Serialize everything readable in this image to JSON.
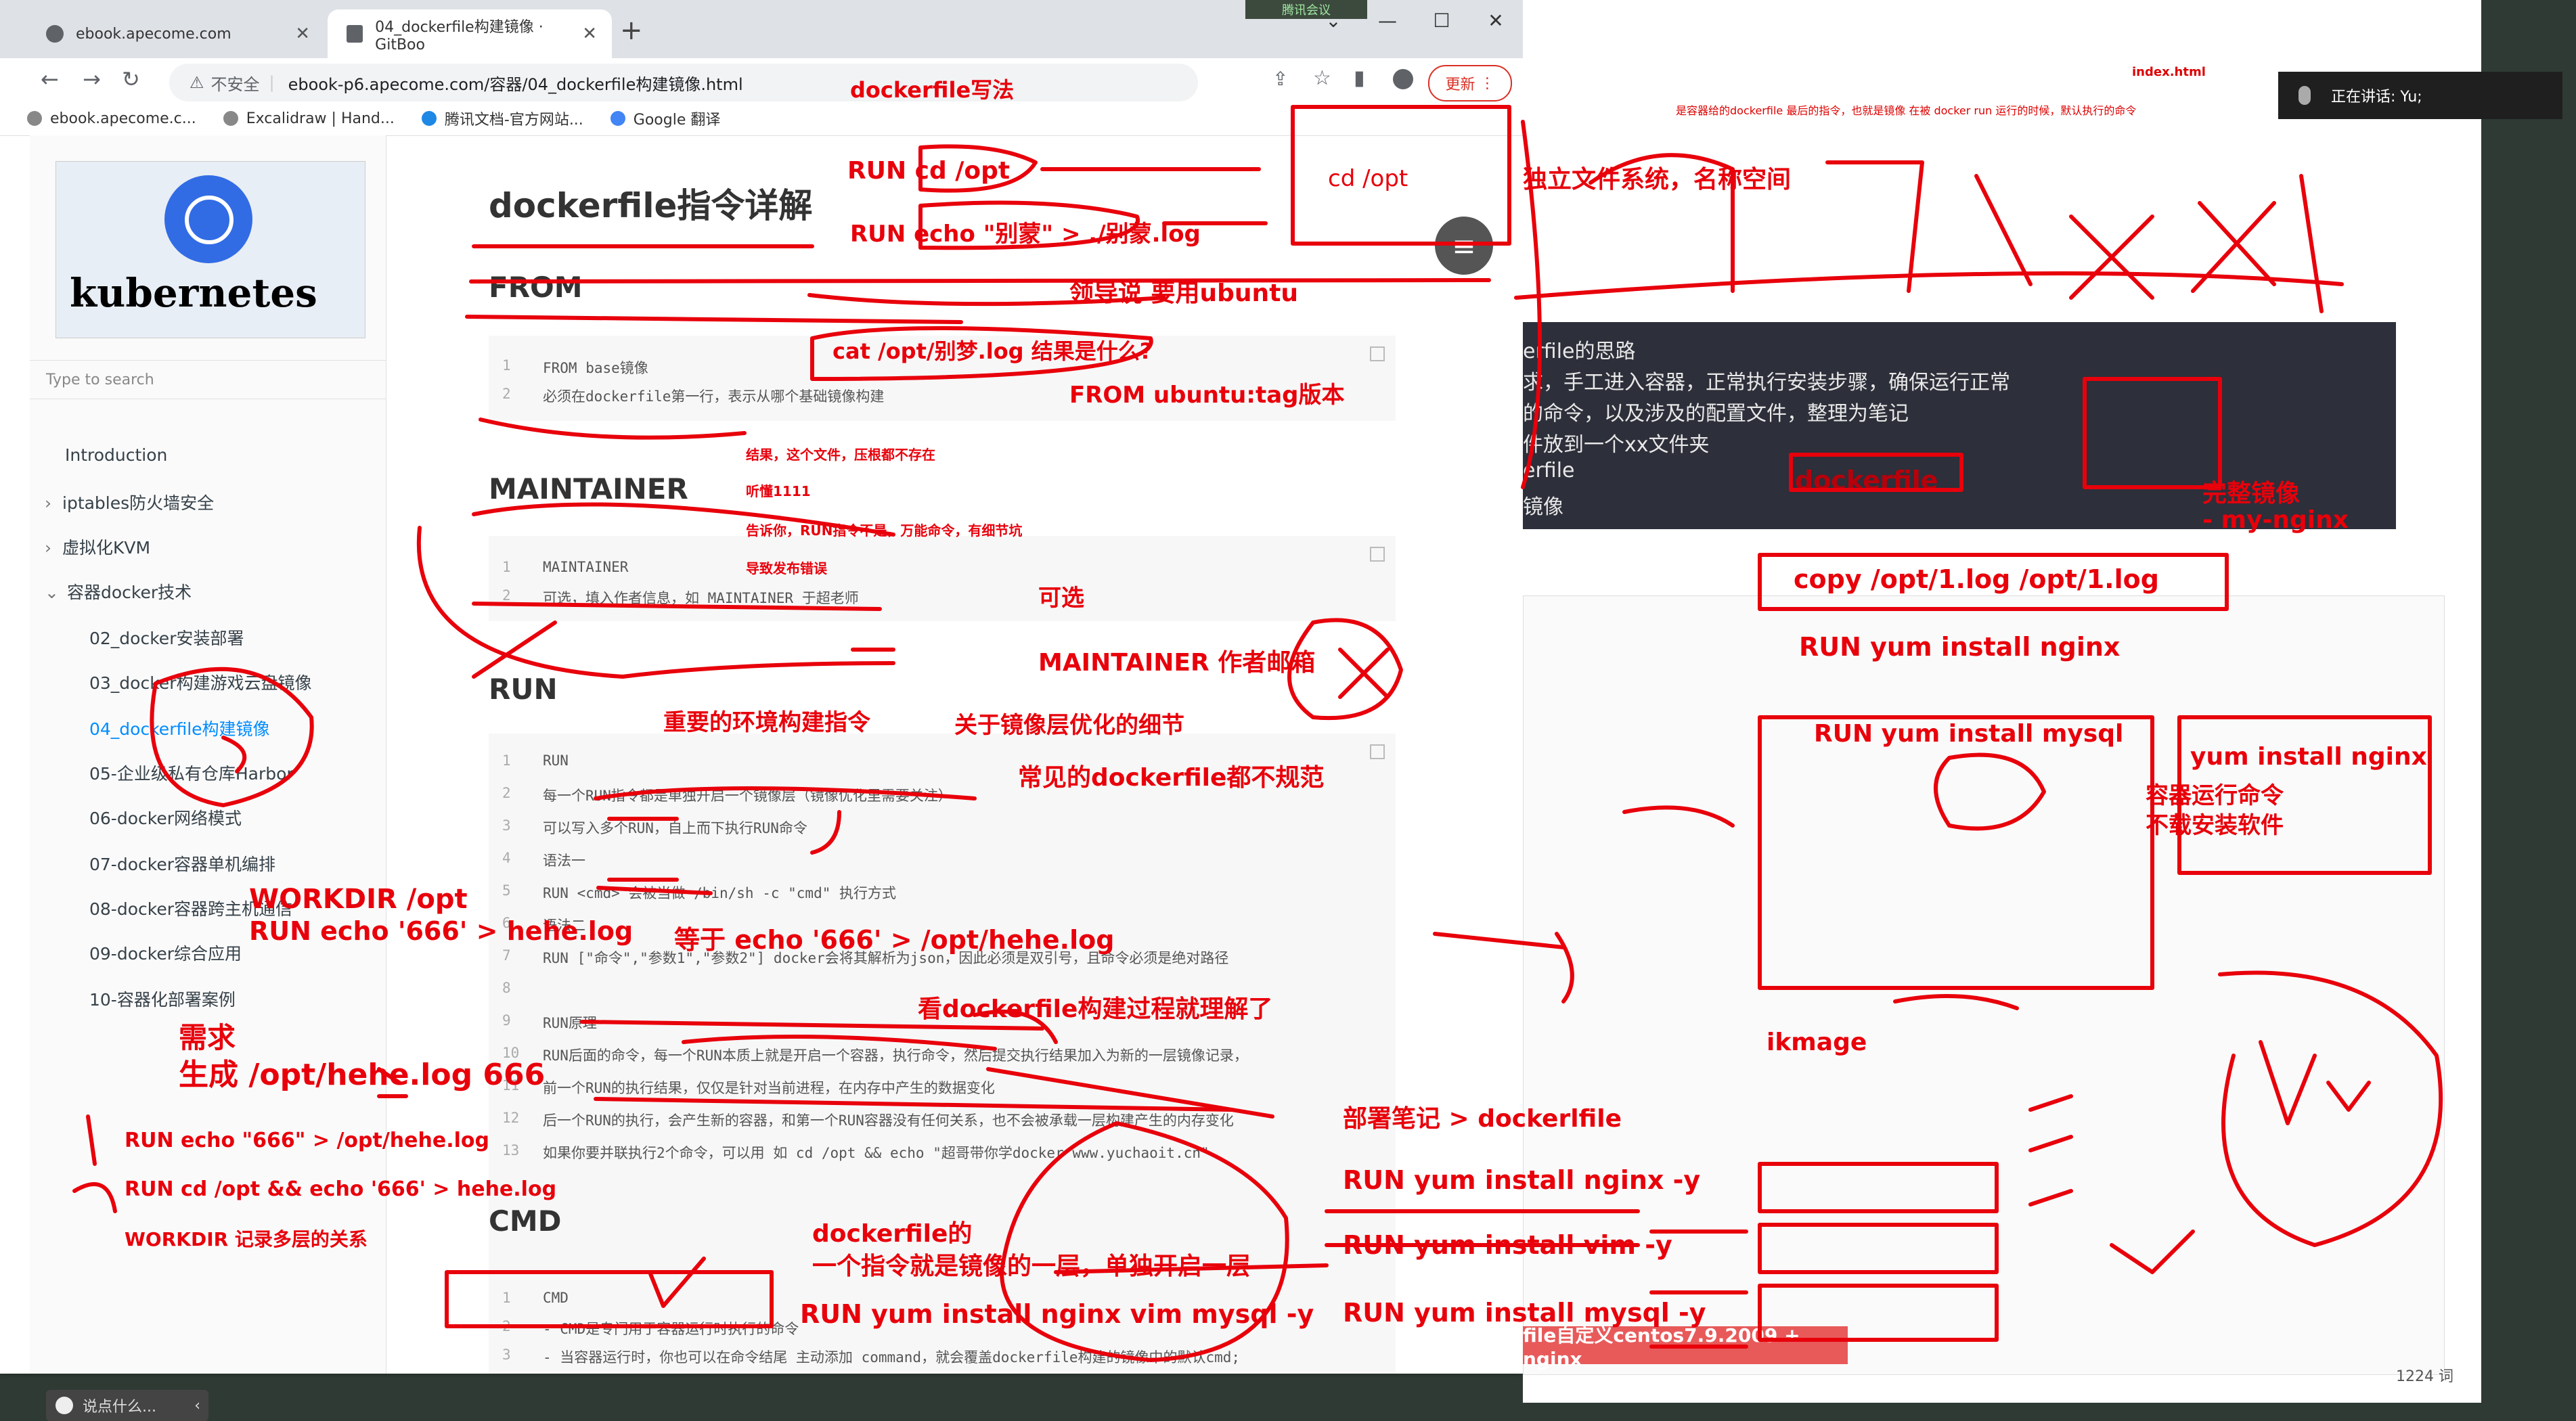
{
  "browser": {
    "tabs": [
      {
        "label": "ebook.apecome.com"
      },
      {
        "label": "04_dockerfile构建镜像 · GitBoo"
      }
    ],
    "meeting_badge": "腾讯会议",
    "security_label": "不安全",
    "url": "ebook-p6.apecome.com/容器/04_dockerfile构建镜像.html",
    "update_label": "更新",
    "bookmarks": [
      "ebook.apecome.c...",
      "Excalidraw | Hand...",
      "腾讯文档-官方网站...",
      "Google 翻译"
    ]
  },
  "sidebar": {
    "logo_text": "kubernetes",
    "search_placeholder": "Type to search",
    "items": [
      {
        "label": "Introduction"
      },
      {
        "label": "iptables防火墙安全"
      },
      {
        "label": "虚拟化KVM"
      },
      {
        "label": "容器docker技术"
      },
      {
        "label": "02_docker安装部署"
      },
      {
        "label": "03_docker构建游戏云盘镜像"
      },
      {
        "label": "04_dockerfile构建镜像"
      },
      {
        "label": "05-企业级私有仓库Harbor"
      },
      {
        "label": "06-docker网络模式"
      },
      {
        "label": "07-docker容器单机编排"
      },
      {
        "label": "08-docker容器跨主机通信"
      },
      {
        "label": "09-docker综合应用"
      },
      {
        "label": "10-容器化部署案例"
      }
    ],
    "chat_placeholder": "说点什么..."
  },
  "main": {
    "title": "dockerfile指令详解",
    "sections": {
      "from": "FROM",
      "maintainer": "MAINTAINER",
      "run": "RUN",
      "cmd": "CMD"
    },
    "from_code": [
      "FROM base镜像",
      "必须在dockerfile第一行，表示从哪个基础镜像构建"
    ],
    "maintainer_code": [
      "MAINTAINER",
      "可选，填入作者信息，如 MAINTAINER 于超老师"
    ],
    "run_code": [
      "RUN",
      "每一个RUN指令都是单独开启一个镜像层（镜像优化里需要关注）",
      "可以写入多个RUN，自上而下执行RUN命令",
      "语法一",
      "RUN <cmd>  会被当做 /bin/sh -c \"cmd\" 执行方式",
      "语法二",
      "RUN [\"命令\",\"参数1\",\"参数2\"] docker会将其解析为json，因此必须是双引号，且命令必须是绝对路径",
      "",
      "RUN原理",
      "RUN后面的命令，每一个RUN本质上就是开启一个容器，执行命令，然后提交执行结果加入为新的一层镜像记录，",
      "前一个RUN的执行结果，仅仅是针对当前进程，在内存中产生的数据变化",
      "后一个RUN的执行，会产生新的容器，和第一个RUN容器没有任何关系，也不会被承载一层构建产生的内存变化",
      "如果你要并联执行2个命令，可以用 如 cd /opt && echo \"超哥带你学docker www.yuchaoit.cn\""
    ],
    "cmd_code": [
      "CMD",
      "- CMD是专门用于容器运行时执行的命令",
      "- 当容器运行时，你也可以在命令结尾 主动添加 command，就会覆盖dockerfile构建的镜像中的默认cmd;"
    ]
  },
  "right_panel": {
    "index_label": "index.html",
    "top_note": "是容器给的dockerfile 最后的指令，也就是镜像 在被 docker run 运行的时候，默认执行的命令",
    "dark_lines": [
      "erfile的思路",
      "求，手工进入容器，正常执行安装步骤，确保运行正常",
      "的命令，以及涉及的配置文件，整理为笔记",
      "件放到一个xx文件夹",
      "erfile",
      "镜像"
    ],
    "meeting_label": "正在讲话: Yu;",
    "words": "1224 词",
    "bottom_banner": "file自定义centos7.9.2009 + nginx"
  },
  "annotations": [
    {
      "text": "dockerfile写法"
    },
    {
      "text": "RUN  cd /opt"
    },
    {
      "text": "RUN  echo \"别蒙\" > ./别蒙.log"
    },
    {
      "text": "cd  /opt"
    },
    {
      "text": "领导说 要用ubuntu"
    },
    {
      "text": "cat  /opt/别梦.log 结果是什么?"
    },
    {
      "text": "FROM  ubuntu:tag版本"
    },
    {
      "text": "结果，这个文件，压根都不存在"
    },
    {
      "text": "听懂1111"
    },
    {
      "text": "告诉你，RUN指令不是，万能命令，有细节坑"
    },
    {
      "text": "导致发布错误"
    },
    {
      "text": "可选"
    },
    {
      "text": "MAINTAINER  作者邮箱"
    },
    {
      "text": "重要的环境构建指令"
    },
    {
      "text": "关于镜像层优化的细节"
    },
    {
      "text": "常见的dockerfile都不规范"
    },
    {
      "text": "WORKDIR /opt"
    },
    {
      "text": "RUN echo '666' > hehe.log"
    },
    {
      "text": "等于  echo '666'  >  /opt/hehe.log"
    },
    {
      "text": "看dockerfile构建过程就理解了"
    },
    {
      "text": "需求"
    },
    {
      "text": "生成  /opt/hehe.log  666"
    },
    {
      "text": "RUN   echo \"666\"   > /opt/hehe.log"
    },
    {
      "text": "RUN   cd /opt   && echo '666'   > hehe.log"
    },
    {
      "text": "WORKDIR   记录多层的关系"
    },
    {
      "text": "部署笔记 > dockerlfile"
    },
    {
      "text": "dockerfile的"
    },
    {
      "text": "一个指令就是镜像的一层，单独开启一层"
    },
    {
      "text": "RUN   yum install nginx vim mysql -y"
    },
    {
      "text": "RUN yum install nginx -y"
    },
    {
      "text": "RUN yum install vim  -y"
    },
    {
      "text": "RUN  yum install mysql -y"
    },
    {
      "text": "独立文件系统，名称空间"
    },
    {
      "text": "dockerfile"
    },
    {
      "text": "完整镜像"
    },
    {
      "text": "- my-nginx"
    },
    {
      "text": "copy  /opt/1.log  /opt/1.log"
    },
    {
      "text": "RUN  yum install nginx"
    },
    {
      "text": "RUN yum install mysql"
    },
    {
      "text": "yum install nginx"
    },
    {
      "text": "容器运行命令"
    },
    {
      "text": "不载安装软件"
    },
    {
      "text": "ikmage"
    }
  ],
  "colors": {
    "ink": "#e8000b",
    "sidebar_active": "#008cff",
    "dark_panel": "#2d2f3a"
  }
}
